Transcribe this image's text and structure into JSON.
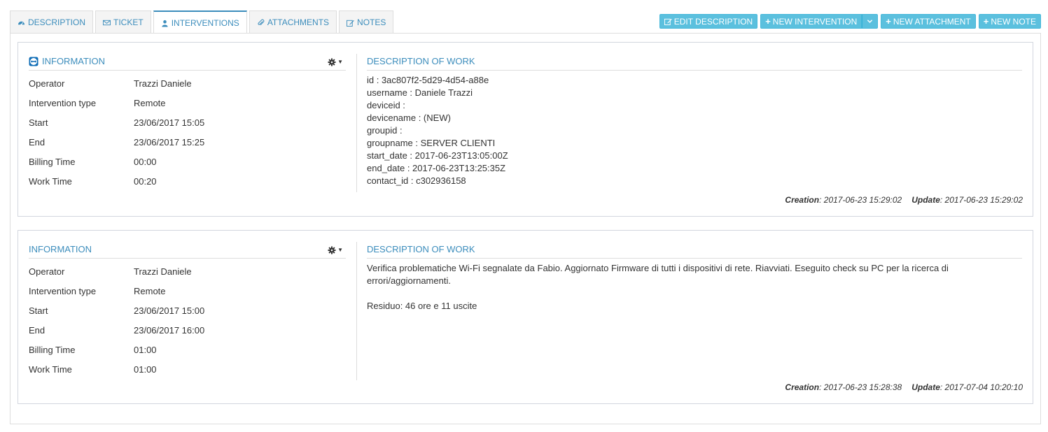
{
  "tabs": [
    {
      "label": "DESCRIPTION",
      "icon": "dashboard-icon"
    },
    {
      "label": "TICKET",
      "icon": "envelope-icon"
    },
    {
      "label": "INTERVENTIONS",
      "icon": "user-icon"
    },
    {
      "label": "ATTACHMENTS",
      "icon": "paperclip-icon"
    },
    {
      "label": "NOTES",
      "icon": "edit-icon"
    }
  ],
  "actions": {
    "edit_description": "EDIT DESCRIPTION",
    "new_intervention": "NEW INTERVENTION",
    "new_attachment": "NEW ATTACHMENT",
    "new_note": "NEW NOTE"
  },
  "interventions": [
    {
      "info_title": "INFORMATION",
      "desc_title": "DESCRIPTION OF WORK",
      "fields": [
        {
          "label": "Operator",
          "value": "Trazzi Daniele"
        },
        {
          "label": "Intervention type",
          "value": "Remote"
        },
        {
          "label": "Start",
          "value": "23/06/2017 15:05"
        },
        {
          "label": "End",
          "value": "23/06/2017 15:25"
        },
        {
          "label": "Billing Time",
          "value": "00:00"
        },
        {
          "label": "Work Time",
          "value": "00:20"
        }
      ],
      "description_lines": [
        "id : 3ac807f2-5d29-4d54-a88e",
        "username : Daniele Trazzi",
        "deviceid :",
        "devicename : (NEW)",
        "groupid :",
        "groupname : SERVER CLIENTI",
        "start_date : 2017-06-23T13:05:00Z",
        "end_date : 2017-06-23T13:25:35Z",
        "contact_id : c302936158"
      ],
      "creation_label": "Creation",
      "creation": ": 2017-06-23 15:29:02",
      "update_label": "Update",
      "update": ": 2017-06-23 15:29:02"
    },
    {
      "info_title": "INFORMATION",
      "desc_title": "DESCRIPTION OF WORK",
      "fields": [
        {
          "label": "Operator",
          "value": "Trazzi Daniele"
        },
        {
          "label": "Intervention type",
          "value": "Remote"
        },
        {
          "label": "Start",
          "value": "23/06/2017 15:00"
        },
        {
          "label": "End",
          "value": "23/06/2017 16:00"
        },
        {
          "label": "Billing Time",
          "value": "01:00"
        },
        {
          "label": "Work Time",
          "value": "01:00"
        }
      ],
      "description_para": "Verifica problematiche Wi-Fi segnalate da Fabio. Aggiornato Firmware di tutti i dispositivi di rete. Riavviati. Eseguito check su PC per la ricerca di errori/aggiornamenti.",
      "description_residual": "Residuo: 46 ore e 11 uscite",
      "creation_label": "Creation",
      "creation": ": 2017-06-23 15:28:38",
      "update_label": "Update",
      "update": ": 2017-07-04 10:20:10"
    }
  ],
  "colors": {
    "accent": "#3c8dbc",
    "button": "#5bc0de"
  }
}
